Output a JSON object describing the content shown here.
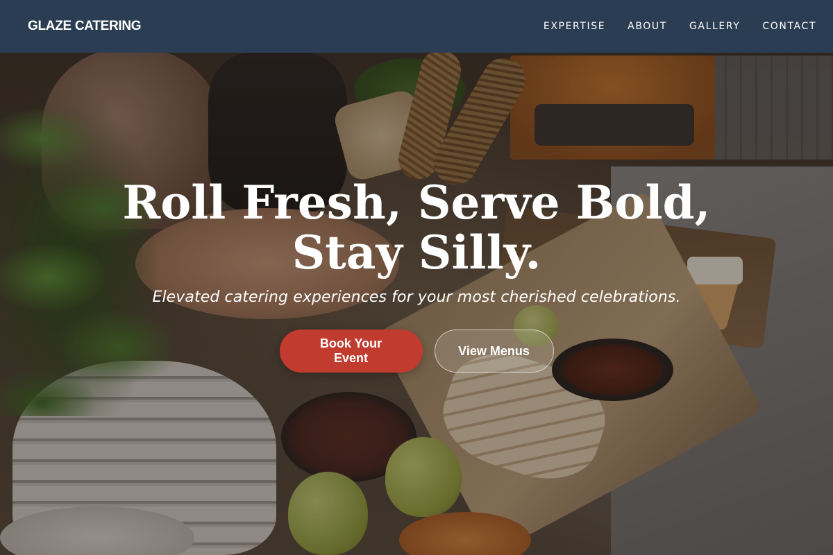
{
  "navbar": {
    "brand": "GLAZE CATERING",
    "links": [
      {
        "label": "EXPERTISE"
      },
      {
        "label": "ABOUT"
      },
      {
        "label": "GALLERY"
      },
      {
        "label": "CONTACT"
      }
    ]
  },
  "hero": {
    "title_line1": "Roll Fresh, Serve Bold,",
    "title_line2": "Stay Silly.",
    "subtitle": "Elevated catering experiences for your most cherished celebrations.",
    "primary_cta": "Book Your Event",
    "secondary_cta": "View Menus"
  },
  "colors": {
    "navbar_bg": "#2c3e54",
    "primary_button": "#c23b2f",
    "text": "#ffffff"
  }
}
